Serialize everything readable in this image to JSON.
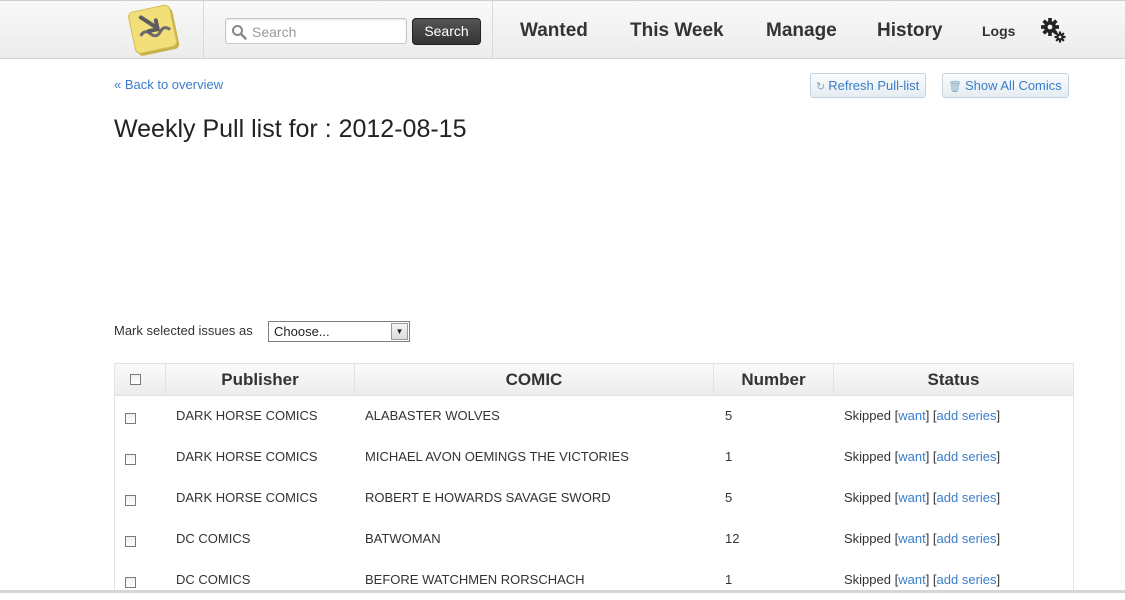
{
  "header": {
    "search_placeholder": "Search",
    "search_button": "Search",
    "nav": [
      "Wanted",
      "This Week",
      "Manage",
      "History",
      "Logs"
    ]
  },
  "toolbar": {
    "back_link": "« Back to overview",
    "refresh_button": "Refresh Pull-list",
    "show_all_button": "Show All Comics"
  },
  "page_title": "Weekly Pull list for : 2012-08-15",
  "mark": {
    "label": "Mark selected issues as",
    "selected": "Choose..."
  },
  "table": {
    "columns": [
      "Publisher",
      "COMIC",
      "Number",
      "Status"
    ],
    "rows": [
      {
        "publisher": "DARK HORSE COMICS",
        "comic": "ALABASTER WOLVES",
        "number": "5",
        "status": "Skipped"
      },
      {
        "publisher": "DARK HORSE COMICS",
        "comic": "MICHAEL AVON OEMINGS THE VICTORIES",
        "number": "1",
        "status": "Skipped"
      },
      {
        "publisher": "DARK HORSE COMICS",
        "comic": "ROBERT E HOWARDS SAVAGE SWORD",
        "number": "5",
        "status": "Skipped"
      },
      {
        "publisher": "DC COMICS",
        "comic": "BATWOMAN",
        "number": "12",
        "status": "Skipped"
      },
      {
        "publisher": "DC COMICS",
        "comic": "BEFORE WATCHMEN RORSCHACH",
        "number": "1",
        "status": "Skipped"
      }
    ],
    "action_want": "want",
    "action_add_series": "add series"
  }
}
